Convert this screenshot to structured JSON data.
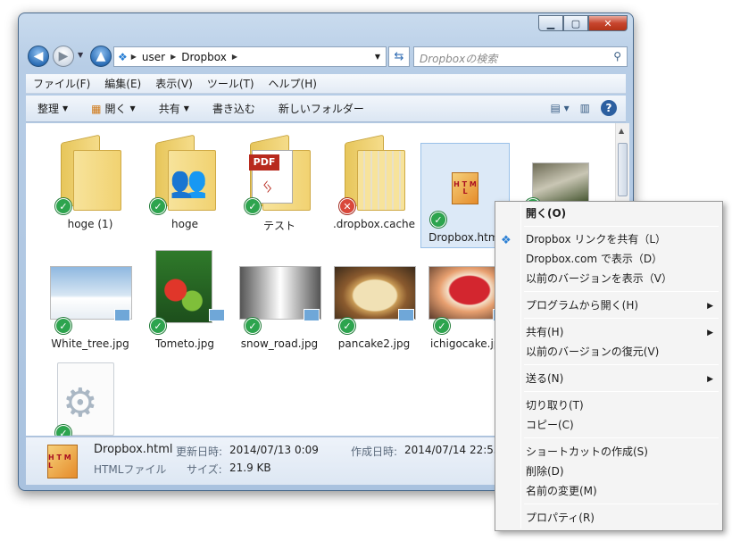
{
  "address": {
    "segments": [
      "user",
      "Dropbox"
    ]
  },
  "search": {
    "placeholder": "Dropboxの検索"
  },
  "menu": [
    "ファイル(F)",
    "編集(E)",
    "表示(V)",
    "ツール(T)",
    "ヘルプ(H)"
  ],
  "toolbar": {
    "organize": "整理",
    "open": "開く",
    "share": "共有",
    "burn": "書き込む",
    "new_folder": "新しいフォルダー",
    "help": "?"
  },
  "items": [
    {
      "label": "hoge (1)",
      "kind": "folder",
      "sync": "ok"
    },
    {
      "label": "hoge",
      "kind": "folder-users",
      "sync": "ok"
    },
    {
      "label": "テスト",
      "kind": "folder-pdf",
      "sync": "ok"
    },
    {
      "label": ".dropbox.cache",
      "kind": "folder",
      "sync": "error"
    },
    {
      "label": "Dropbox.html",
      "kind": "html",
      "sync": "ok"
    },
    {
      "label": "",
      "kind": "photo",
      "sync": "ok"
    },
    {
      "label": "White_tree.jpg",
      "kind": "photo",
      "sync": "ok"
    },
    {
      "label": "Tometo.jpg",
      "kind": "photo",
      "sync": "ok"
    },
    {
      "label": "snow_road.jpg",
      "kind": "photo",
      "sync": "ok"
    },
    {
      "label": "pancake2.jpg",
      "kind": "photo",
      "sync": "ok"
    },
    {
      "label": "ichigocake.jpg",
      "kind": "photo",
      "sync": "ok"
    },
    {
      "label": "",
      "kind": "config",
      "sync": "ok"
    }
  ],
  "pdf_tag": "PDF",
  "html_icon_text": "H T M L",
  "status": {
    "name": "Dropbox.html",
    "modified_label": "更新日時:",
    "modified": "2014/07/13 0:09",
    "created_label": "作成日時:",
    "created": "2014/07/14 22:53",
    "type": "HTMLファイル",
    "size_label": "サイズ:",
    "size": "21.9 KB"
  },
  "context_menu": {
    "open": "開く(O)",
    "dropbox_share": "Dropbox リンクを共有（L）",
    "dropbox_view": "Dropbox.com で表示（D）",
    "prev_versions": "以前のバージョンを表示（V）",
    "open_with": "プログラムから開く(H)",
    "share": "共有(H)",
    "restore": "以前のバージョンの復元(V)",
    "send_to": "送る(N)",
    "cut": "切り取り(T)",
    "copy": "コピー(C)",
    "shortcut": "ショートカットの作成(S)",
    "delete": "削除(D)",
    "rename": "名前の変更(M)",
    "properties": "プロパティ(R)"
  },
  "colors": {
    "ok": "#2da44e",
    "error": "#d9483b",
    "selection": "#dce9f7"
  }
}
